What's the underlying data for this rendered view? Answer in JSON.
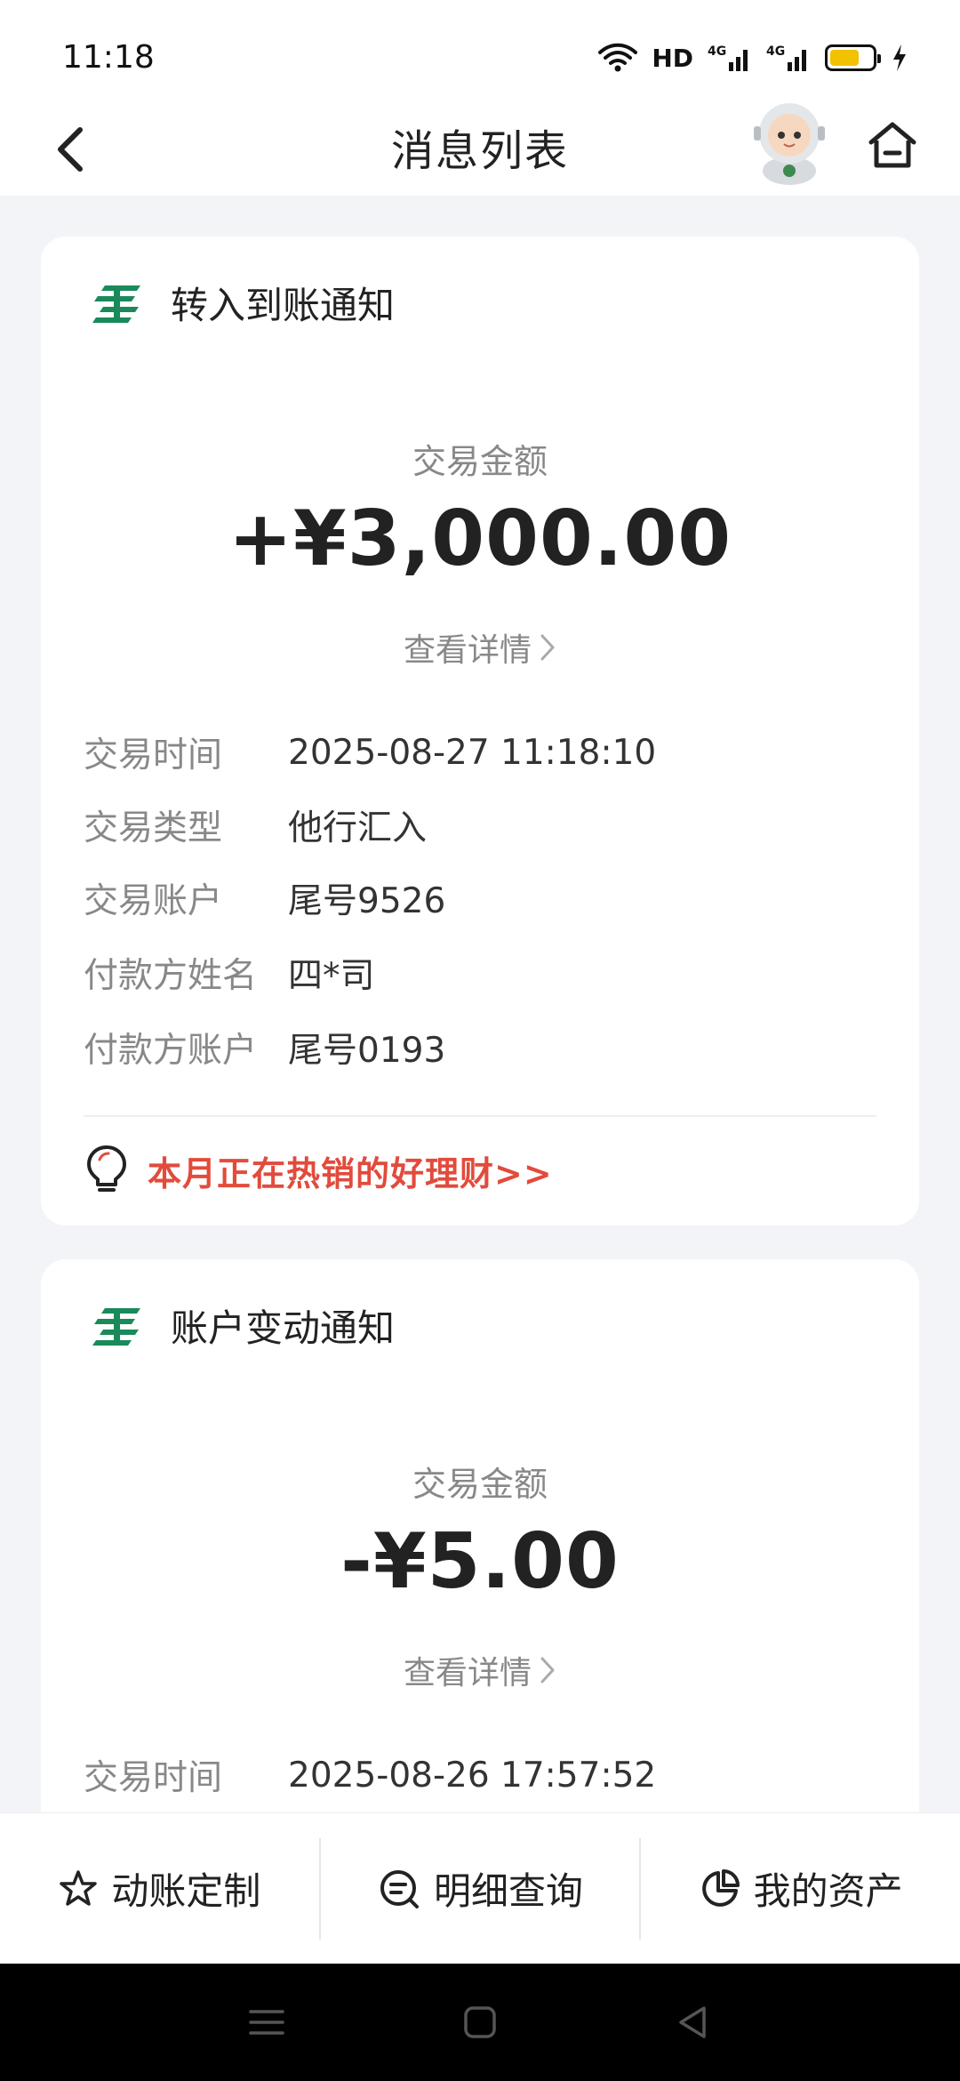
{
  "status_bar": {
    "time": "11:18",
    "hd_label": "HD",
    "net_1": "4G",
    "net_2": "4G",
    "battery_color": "#f2c200"
  },
  "header": {
    "title": "消息列表"
  },
  "cards": [
    {
      "title": "转入到账通知",
      "amount_label": "交易金额",
      "amount": "+¥3,000.00",
      "detail_link": "查看详情",
      "rows": [
        {
          "label": "交易时间",
          "value": "2025-08-27 11:18:10"
        },
        {
          "label": "交易类型",
          "value": "他行汇入"
        },
        {
          "label": "交易账户",
          "value": "尾号9526"
        },
        {
          "label": "付款方姓名",
          "value": "四*司"
        },
        {
          "label": "付款方账户",
          "value": "尾号0193"
        }
      ],
      "promo": "本月正在热销的好理财>>"
    },
    {
      "title": "账户变动通知",
      "amount_label": "交易金额",
      "amount": "-¥5.00",
      "detail_link": "查看详情",
      "rows": [
        {
          "label": "交易时间",
          "value": "2025-08-26 17:57:52"
        }
      ]
    }
  ],
  "bottom_tabs": [
    {
      "label": "动账定制",
      "icon": "star-icon"
    },
    {
      "label": "明细查询",
      "icon": "search-list-icon"
    },
    {
      "label": "我的资产",
      "icon": "pie-chart-icon"
    }
  ],
  "colors": {
    "brand_green": "#1a8a5a",
    "promo_red": "#e24b3c",
    "background": "#f3f4f8"
  }
}
